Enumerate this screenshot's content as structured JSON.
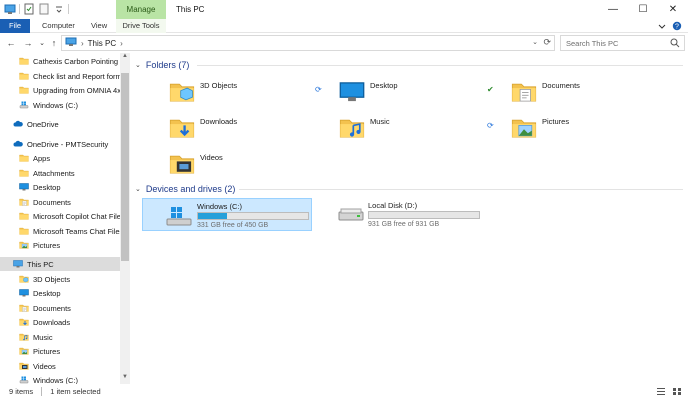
{
  "window": {
    "title": "This PC",
    "manage_tab": "Manage",
    "controls": {
      "minimize": "—",
      "maximize": "☐",
      "close": "✕"
    }
  },
  "ribbon": {
    "tabs": [
      "File",
      "Computer",
      "View",
      "Drive Tools"
    ]
  },
  "address": {
    "back": "←",
    "forward": "→",
    "recent": "⌄",
    "up": "↑",
    "crumb": "This PC",
    "search_placeholder": "Search This PC"
  },
  "nav": {
    "items": [
      {
        "label": "Cathexis Carbon Pointing to",
        "icon": "folder-icon"
      },
      {
        "label": "Check list and Report form f",
        "icon": "folder-icon"
      },
      {
        "label": "Upgrading from OMNIA 4x",
        "icon": "folder-icon"
      },
      {
        "label": "Windows (C:)",
        "icon": "drive-icon"
      },
      {
        "label": "OneDrive",
        "icon": "cloud-icon"
      },
      {
        "label": "OneDrive - PMTSecurity",
        "icon": "cloud-icon"
      },
      {
        "label": "Apps",
        "icon": "folder-icon"
      },
      {
        "label": "Attachments",
        "icon": "folder-icon"
      },
      {
        "label": "Desktop",
        "icon": "desktop-icon"
      },
      {
        "label": "Documents",
        "icon": "documents-icon"
      },
      {
        "label": "Microsoft Copilot Chat Files",
        "icon": "folder-icon"
      },
      {
        "label": "Microsoft Teams Chat Files",
        "icon": "folder-icon"
      },
      {
        "label": "Pictures",
        "icon": "pictures-icon"
      },
      {
        "label": "This PC",
        "icon": "computer-icon"
      },
      {
        "label": "3D Objects",
        "icon": "3d-objects-icon"
      },
      {
        "label": "Desktop",
        "icon": "desktop-icon"
      },
      {
        "label": "Documents",
        "icon": "documents-icon"
      },
      {
        "label": "Downloads",
        "icon": "downloads-icon"
      },
      {
        "label": "Music",
        "icon": "music-icon"
      },
      {
        "label": "Pictures",
        "icon": "pictures-icon"
      },
      {
        "label": "Videos",
        "icon": "videos-icon"
      },
      {
        "label": "Windows (C:)",
        "icon": "drive-icon"
      }
    ]
  },
  "folders": {
    "header": "Folders (7)",
    "items": [
      {
        "label": "3D Objects",
        "icon": "3d-objects-icon"
      },
      {
        "label": "Desktop",
        "icon": "desktop-icon"
      },
      {
        "label": "Documents",
        "icon": "documents-icon"
      },
      {
        "label": "Downloads",
        "icon": "downloads-icon"
      },
      {
        "label": "Music",
        "icon": "music-icon"
      },
      {
        "label": "Pictures",
        "icon": "pictures-icon"
      },
      {
        "label": "Videos",
        "icon": "videos-icon"
      }
    ]
  },
  "drives": {
    "header": "Devices and drives (2)",
    "items": [
      {
        "label": "Windows (C:)",
        "free": "331 GB free of 450 GB",
        "used_fraction": 0.264
      },
      {
        "label": "Local Disk (D:)",
        "free": "931 GB free of 931 GB",
        "used_fraction": 0.0
      }
    ]
  },
  "status": {
    "count": "9 items",
    "selection": "1 item selected"
  },
  "colors": {
    "accent": "#1a5fb4",
    "manage": "#b9e4a5",
    "selection": "#cce8ff",
    "drive_fill": "#26a0da",
    "header_text": "#1e3a8a"
  }
}
